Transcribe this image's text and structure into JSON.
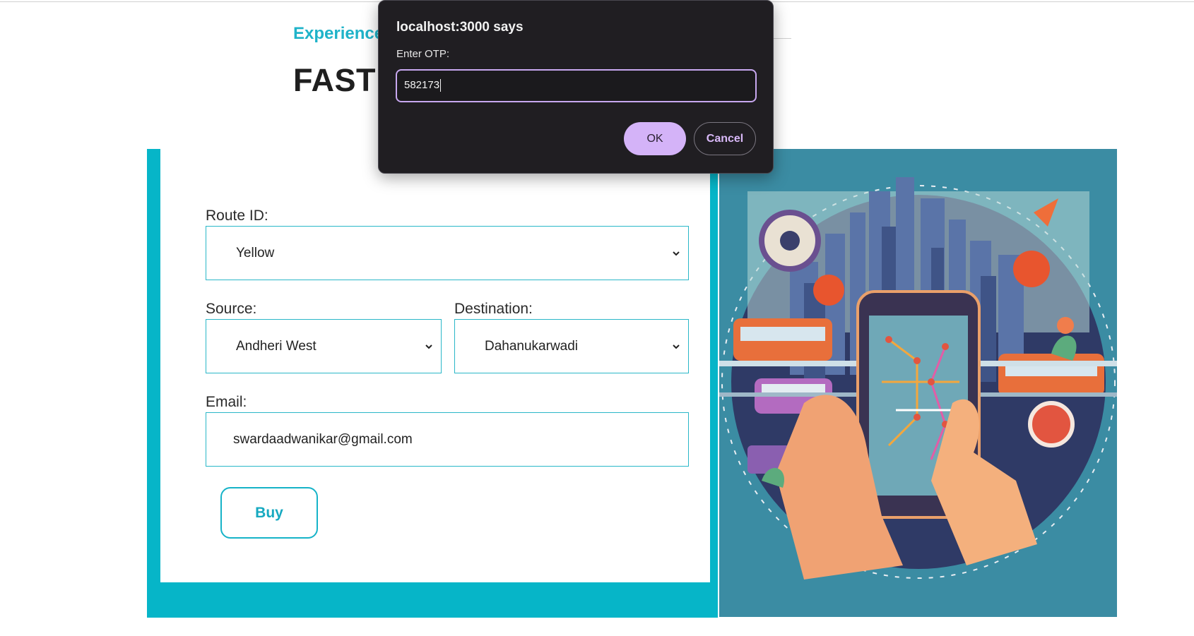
{
  "header": {
    "experience_text": "Experience",
    "title": "FASTER TICKET BOOKING"
  },
  "form": {
    "route_label": "Route ID:",
    "route_value": "Yellow",
    "source_label": "Source:",
    "source_value": "Andheri West",
    "destination_label": "Destination:",
    "destination_value": "Dahanukarwadi",
    "email_label": "Email:",
    "email_value": "swardaadwanikar@gmail.com",
    "buy_label": "Buy"
  },
  "dialog": {
    "title": "localhost:3000 says",
    "message": "Enter OTP:",
    "input_value": "582173",
    "ok_label": "OK",
    "cancel_label": "Cancel"
  },
  "colors": {
    "accent": "#06b5c8",
    "dialog_bg": "#201e22",
    "dialog_button": "#d4b3f8",
    "illustration_bg": "#3b8ca3"
  }
}
